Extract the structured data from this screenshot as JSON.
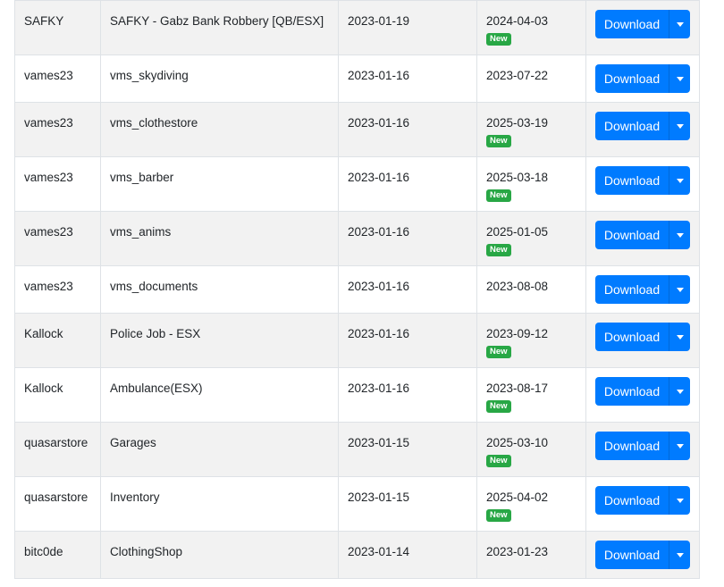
{
  "table": {
    "download_label": "Download",
    "new_label": "New",
    "rows": [
      {
        "author": "SAFKY",
        "name": "SAFKY - Gabz Bank Robbery [QB/ESX]",
        "created": "2023-01-19",
        "updated": "2024-04-03",
        "is_new": true
      },
      {
        "author": "vames23",
        "name": "vms_skydiving",
        "created": "2023-01-16",
        "updated": "2023-07-22",
        "is_new": false
      },
      {
        "author": "vames23",
        "name": "vms_clothestore",
        "created": "2023-01-16",
        "updated": "2025-03-19",
        "is_new": true
      },
      {
        "author": "vames23",
        "name": "vms_barber",
        "created": "2023-01-16",
        "updated": "2025-03-18",
        "is_new": true
      },
      {
        "author": "vames23",
        "name": "vms_anims",
        "created": "2023-01-16",
        "updated": "2025-01-05",
        "is_new": true
      },
      {
        "author": "vames23",
        "name": "vms_documents",
        "created": "2023-01-16",
        "updated": "2023-08-08",
        "is_new": false
      },
      {
        "author": "Kallock",
        "name": "Police Job - ESX",
        "created": "2023-01-16",
        "updated": "2023-09-12",
        "is_new": true
      },
      {
        "author": "Kallock",
        "name": "Ambulance(ESX)",
        "created": "2023-01-16",
        "updated": "2023-08-17",
        "is_new": true
      },
      {
        "author": "quasarstore",
        "name": "Garages",
        "created": "2023-01-15",
        "updated": "2025-03-10",
        "is_new": true
      },
      {
        "author": "quasarstore",
        "name": "Inventory",
        "created": "2023-01-15",
        "updated": "2025-04-02",
        "is_new": true
      },
      {
        "author": "bitc0de",
        "name": "ClothingShop",
        "created": "2023-01-14",
        "updated": "2023-01-23",
        "is_new": false
      }
    ]
  },
  "colors": {
    "primary_button": "#007bff",
    "new_badge": "#28a745",
    "striped_row": "#f2f2f2",
    "border": "#dee2e6"
  },
  "icons": {
    "dropdown_toggle": "caret-down-icon"
  }
}
